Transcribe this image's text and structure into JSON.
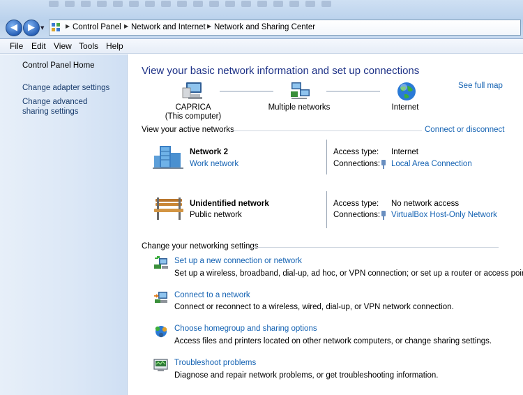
{
  "address": {
    "crumbs": [
      "Control Panel",
      "Network and Internet",
      "Network and Sharing Center"
    ]
  },
  "menu": [
    "File",
    "Edit",
    "View",
    "Tools",
    "Help"
  ],
  "sidebar": {
    "items": [
      "Control Panel Home",
      "Change adapter settings",
      "Change advanced sharing settings"
    ]
  },
  "main": {
    "title": "View your basic network information and set up connections",
    "see_full_map": "See full map",
    "map": {
      "computer_name": "CAPRICA",
      "computer_sub": "(This computer)",
      "middle": "Multiple networks",
      "internet": "Internet"
    },
    "active_header": "View your active networks",
    "connect_link": "Connect or disconnect",
    "networks": [
      {
        "name": "Network  2",
        "type_label": "Work network",
        "access_label": "Access type:",
        "access_value": "Internet",
        "conn_label": "Connections:",
        "conn_value": "Local Area Connection"
      },
      {
        "name": "Unidentified network",
        "type_label": "Public network",
        "access_label": "Access type:",
        "access_value": "No network access",
        "conn_label": "Connections:",
        "conn_value": "VirtualBox Host-Only Network"
      }
    ],
    "settings_header": "Change your networking settings",
    "tasks": [
      {
        "title": "Set up a new connection or network",
        "desc": "Set up a wireless, broadband, dial-up, ad hoc, or VPN connection; or set up a router or access point.",
        "icon": "new-connection-icon"
      },
      {
        "title": "Connect to a network",
        "desc": "Connect or reconnect to a wireless, wired, dial-up, or VPN network connection.",
        "icon": "connect-network-icon"
      },
      {
        "title": "Choose homegroup and sharing options",
        "desc": "Access files and printers located on other network computers, or change sharing settings.",
        "icon": "homegroup-icon"
      },
      {
        "title": "Troubleshoot problems",
        "desc": "Diagnose and repair network problems, or get troubleshooting information.",
        "icon": "troubleshoot-icon"
      }
    ]
  }
}
